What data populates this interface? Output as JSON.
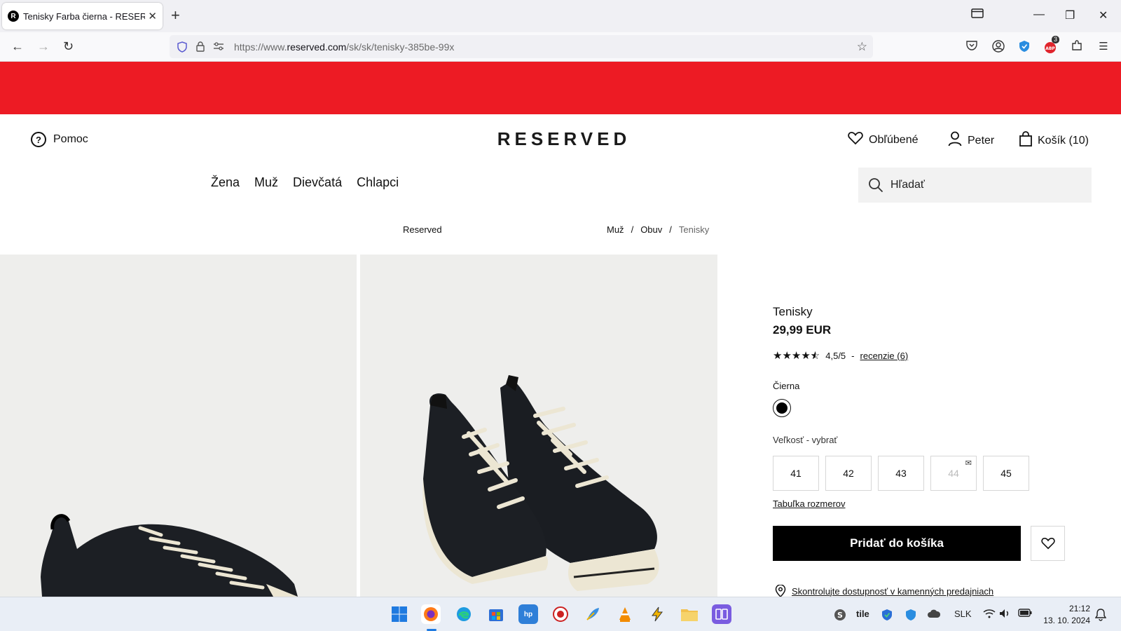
{
  "browser": {
    "tab_title": "Tenisky Farba čierna - RESERVED",
    "tab_favicon": "R",
    "url_prefix": "https://www.",
    "url_domain": "reserved.com",
    "url_path": "/sk/sk/tenisky-385be-99x",
    "extension_badge": "3"
  },
  "site": {
    "banner_color": "#ed1b24",
    "help_label": "Pomoc",
    "logo": "RESERVED",
    "favorites_label": "Obľúbené",
    "user_label": "Peter",
    "cart_label": "Košík (10)",
    "nav": [
      "Žena",
      "Muž",
      "Dievčatá",
      "Chlapci"
    ],
    "search_placeholder": "Hľadať",
    "brand": "Reserved",
    "breadcrumb": [
      "Muž",
      "Obuv",
      "Tenisky"
    ],
    "breadcrumb_sep": "/"
  },
  "product": {
    "title": "Tenisky",
    "price": "29,99 EUR",
    "rating_value": 4.5,
    "rating_text": "4,5/5",
    "rating_dash": "-",
    "reviews_link": "recenzie (6)",
    "color_name": "Čierna",
    "size_label": "Veľkosť -  vybrať",
    "sizes": [
      {
        "label": "41",
        "available": true
      },
      {
        "label": "42",
        "available": true
      },
      {
        "label": "43",
        "available": true
      },
      {
        "label": "44",
        "available": false
      },
      {
        "label": "45",
        "available": true
      }
    ],
    "size_table_link": "Tabuľka rozmerov",
    "add_to_cart": "Pridať do košíka",
    "availability_link": "Skontrolujte dostupnosť v kamenných predajniach"
  },
  "taskbar": {
    "language": "SLK",
    "tray_text": "tile",
    "time": "21:12",
    "date": "13. 10. 2024"
  }
}
